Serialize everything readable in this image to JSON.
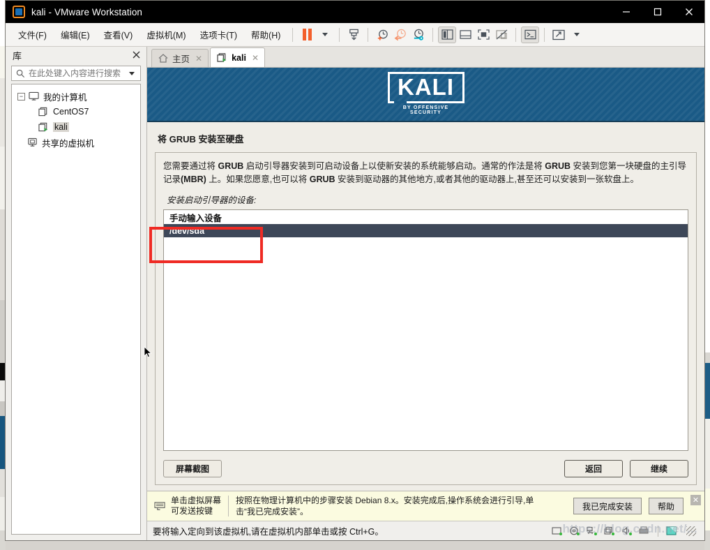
{
  "window": {
    "title": "kali - VMware Workstation",
    "controls": {
      "minimize": "minimize-icon",
      "maximize": "maximize-icon",
      "close": "close-icon"
    }
  },
  "menubar": {
    "items": [
      "文件(F)",
      "编辑(E)",
      "查看(V)",
      "虚拟机(M)",
      "选项卡(T)",
      "帮助(H)"
    ],
    "toolbar_icons": [
      "pause-icon",
      "dropdown-caret-icon",
      "send-ctrl-alt-del-icon",
      "snapshot-take-icon",
      "snapshot-revert-icon",
      "snapshot-manager-icon",
      "show-library-icon",
      "show-thumbnail-bar-icon",
      "full-screen-icon",
      "unity-mode-icon",
      "console-view-icon",
      "stretch-icon",
      "stretch-caret-icon"
    ]
  },
  "library": {
    "title": "库",
    "close_icon": "close-icon",
    "search": {
      "placeholder": "在此处键入内容进行搜索",
      "value": "",
      "icon": "search-icon",
      "dropdown": "chevron-down-icon"
    },
    "tree": [
      {
        "label": "我的计算机",
        "icon": "my-computer-icon",
        "expander": "−",
        "level": 0,
        "selected": false
      },
      {
        "label": "CentOS7",
        "icon": "virtual-machine-icon",
        "level": 1,
        "selected": false
      },
      {
        "label": "kali",
        "icon": "virtual-machine-running-icon",
        "level": 1,
        "selected": true
      },
      {
        "label": "共享的虚拟机",
        "icon": "shared-vms-icon",
        "level": 0,
        "selected": false
      }
    ]
  },
  "tabs": [
    {
      "label": "主页",
      "icon": "home-icon",
      "close_icon": "close-icon",
      "active": false
    },
    {
      "label": "kali",
      "icon": "virtual-machine-running-icon",
      "close_icon": "close-icon",
      "active": true
    }
  ],
  "vm": {
    "banner": {
      "logo_word": "KALI",
      "logo_sub": "BY OFFENSIVE SECURITY"
    },
    "installer": {
      "heading": "将 GRUB 安装至硬盘",
      "description_line1_a": "您需要通过将 ",
      "description_bold1": "GRUB",
      "description_line1_b": " 启动引导器安装到可启动设备上以使新安装的系统能够启动。通常的作法是将 ",
      "description_bold2": "GRUB",
      "description_line1_c": " 安装到您第一块硬盘的主引导记录",
      "description_bold3": "(MBR)",
      "description_line2": " 上。如果您愿意,也可以将 ",
      "description_bold4": "GRUB",
      "description_line2_b": " 安装到驱动器的其他地方,或者其他的驱动器上,甚至还可以安装到一张软盘上。",
      "sublabel": "安装启动引导器的设备:",
      "devices": [
        {
          "label": "手动输入设备",
          "selected": false
        },
        {
          "label": "/dev/sda",
          "selected": true
        }
      ],
      "buttons": {
        "screenshot": "屏幕截图",
        "back": "返回",
        "continue": "继续"
      }
    }
  },
  "annotation": {
    "type": "red-rectangle",
    "color": "#ef2b24"
  },
  "notification": {
    "key_icon": "keyboard-icon",
    "key_hint_line1": "单击虚拟屏幕",
    "key_hint_line2": "可发送按键",
    "message": "按照在物理计算机中的步骤安装 Debian 8.x。安装完成后,操作系统会进行引导,单击“我已完成安装”。",
    "buttons": [
      "我已完成安装",
      "帮助"
    ],
    "close_icon": "close-icon"
  },
  "statusbar": {
    "text": "要将输入定向到该虚拟机,请在虚拟机内部单击或按 Ctrl+G。",
    "device_icons": [
      "hard-disk-icon",
      "cd-dvd-icon",
      "network-adapter-icon",
      "usb-controller-icon",
      "sound-card-icon",
      "printer-icon",
      "display-icon"
    ],
    "watermark": "https://blog.csdn.net/..."
  },
  "colors": {
    "accent_orange": "#f3602c",
    "kali_blue": "#1a5a86",
    "selection_navy": "#3d4758",
    "annotation_red": "#ef2b24",
    "notification_yellow": "#fbfbe0"
  }
}
